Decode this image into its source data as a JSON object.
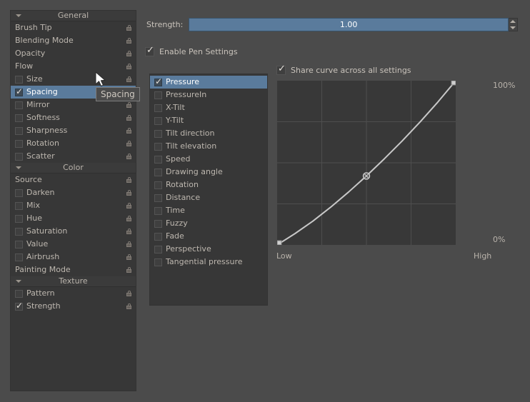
{
  "settings_tree": {
    "groups": [
      {
        "name": "General",
        "expanded": true,
        "items": [
          {
            "label": "Brush Tip",
            "checked": false,
            "indent": false,
            "has_check": false,
            "lock": true,
            "selected": false
          },
          {
            "label": "Blending Mode",
            "checked": false,
            "indent": false,
            "has_check": false,
            "lock": true,
            "selected": false
          },
          {
            "label": "Opacity",
            "checked": false,
            "indent": false,
            "has_check": false,
            "lock": true,
            "selected": false
          },
          {
            "label": "Flow",
            "checked": false,
            "indent": false,
            "has_check": false,
            "lock": true,
            "selected": false
          },
          {
            "label": "Size",
            "checked": false,
            "indent": true,
            "has_check": true,
            "lock": true,
            "selected": false
          },
          {
            "label": "Spacing",
            "checked": true,
            "indent": true,
            "has_check": true,
            "lock": true,
            "selected": true
          },
          {
            "label": "Mirror",
            "checked": false,
            "indent": true,
            "has_check": true,
            "lock": true,
            "selected": false
          },
          {
            "label": "Softness",
            "checked": false,
            "indent": true,
            "has_check": true,
            "lock": true,
            "selected": false
          },
          {
            "label": "Sharpness",
            "checked": false,
            "indent": true,
            "has_check": true,
            "lock": true,
            "selected": false
          },
          {
            "label": "Rotation",
            "checked": false,
            "indent": true,
            "has_check": true,
            "lock": true,
            "selected": false
          },
          {
            "label": "Scatter",
            "checked": false,
            "indent": true,
            "has_check": true,
            "lock": true,
            "selected": false
          }
        ]
      },
      {
        "name": "Color",
        "expanded": true,
        "items": [
          {
            "label": "Source",
            "checked": false,
            "indent": false,
            "has_check": false,
            "lock": true,
            "selected": false
          },
          {
            "label": "Darken",
            "checked": false,
            "indent": true,
            "has_check": true,
            "lock": true,
            "selected": false
          },
          {
            "label": "Mix",
            "checked": false,
            "indent": true,
            "has_check": true,
            "lock": true,
            "selected": false
          },
          {
            "label": "Hue",
            "checked": false,
            "indent": true,
            "has_check": true,
            "lock": true,
            "selected": false
          },
          {
            "label": "Saturation",
            "checked": false,
            "indent": true,
            "has_check": true,
            "lock": true,
            "selected": false
          },
          {
            "label": "Value",
            "checked": false,
            "indent": true,
            "has_check": true,
            "lock": true,
            "selected": false
          },
          {
            "label": "Airbrush",
            "checked": false,
            "indent": true,
            "has_check": true,
            "lock": true,
            "selected": false
          },
          {
            "label": "Painting Mode",
            "checked": false,
            "indent": false,
            "has_check": false,
            "lock": true,
            "selected": false
          }
        ]
      },
      {
        "name": "Texture",
        "expanded": true,
        "items": [
          {
            "label": "Pattern",
            "checked": false,
            "indent": true,
            "has_check": true,
            "lock": true,
            "selected": false
          },
          {
            "label": "Strength",
            "checked": true,
            "indent": true,
            "has_check": true,
            "lock": true,
            "selected": false
          }
        ]
      }
    ]
  },
  "strength": {
    "label": "Strength:",
    "value": "1.00",
    "fill_percent": 100,
    "slider_color": "#5a7b9c",
    "spin_up_icon": "spin-up-icon",
    "spin_down_icon": "spin-down-icon"
  },
  "enable_pen_settings": {
    "label": "Enable Pen Settings",
    "checked": true
  },
  "sensor_list": {
    "items": [
      {
        "label": "Pressure",
        "checked": true,
        "selected": true
      },
      {
        "label": "PressureIn",
        "checked": false,
        "selected": false
      },
      {
        "label": "X-Tilt",
        "checked": false,
        "selected": false
      },
      {
        "label": "Y-Tilt",
        "checked": false,
        "selected": false
      },
      {
        "label": "Tilt direction",
        "checked": false,
        "selected": false
      },
      {
        "label": "Tilt elevation",
        "checked": false,
        "selected": false
      },
      {
        "label": "Speed",
        "checked": false,
        "selected": false
      },
      {
        "label": "Drawing angle",
        "checked": false,
        "selected": false
      },
      {
        "label": "Rotation",
        "checked": false,
        "selected": false
      },
      {
        "label": "Distance",
        "checked": false,
        "selected": false
      },
      {
        "label": "Time",
        "checked": false,
        "selected": false
      },
      {
        "label": "Fuzzy",
        "checked": false,
        "selected": false
      },
      {
        "label": "Fade",
        "checked": false,
        "selected": false
      },
      {
        "label": "Perspective",
        "checked": false,
        "selected": false
      },
      {
        "label": "Tangential pressure",
        "checked": false,
        "selected": false
      }
    ]
  },
  "curve_panel": {
    "share_curve": {
      "label": "Share curve across all settings",
      "checked": true
    },
    "label_top": "100%",
    "label_bottom": "0%",
    "label_left": "Low",
    "label_right": "High"
  },
  "chart_data": {
    "type": "line",
    "title": "",
    "xlabel": "Low → High",
    "ylabel": "0% → 100%",
    "xlim": [
      0,
      1
    ],
    "ylim": [
      0,
      1
    ],
    "grid": true,
    "grid_divisions_x": 4,
    "grid_divisions_y": 4,
    "tick_labels_x": [
      "Low",
      "High"
    ],
    "tick_labels_y": [
      "0%",
      "100%"
    ],
    "legend": null,
    "series": [
      {
        "name": "Pressure response curve",
        "control_points": [
          {
            "x": 0.0,
            "y": 0.0
          },
          {
            "x": 0.5,
            "y": 0.42
          },
          {
            "x": 1.0,
            "y": 1.0
          }
        ],
        "sampled_points": [
          {
            "x": 0.0,
            "y": 0.0
          },
          {
            "x": 0.1,
            "y": 0.069
          },
          {
            "x": 0.2,
            "y": 0.145
          },
          {
            "x": 0.3,
            "y": 0.23
          },
          {
            "x": 0.4,
            "y": 0.322
          },
          {
            "x": 0.5,
            "y": 0.42
          },
          {
            "x": 0.6,
            "y": 0.524
          },
          {
            "x": 0.7,
            "y": 0.633
          },
          {
            "x": 0.8,
            "y": 0.748
          },
          {
            "x": 0.9,
            "y": 0.87
          },
          {
            "x": 1.0,
            "y": 1.0
          }
        ],
        "line_color": "#c8c8c8"
      }
    ]
  },
  "cursor": {
    "icon": "mouse-pointer-icon",
    "tooltip_text": "Spacing"
  }
}
